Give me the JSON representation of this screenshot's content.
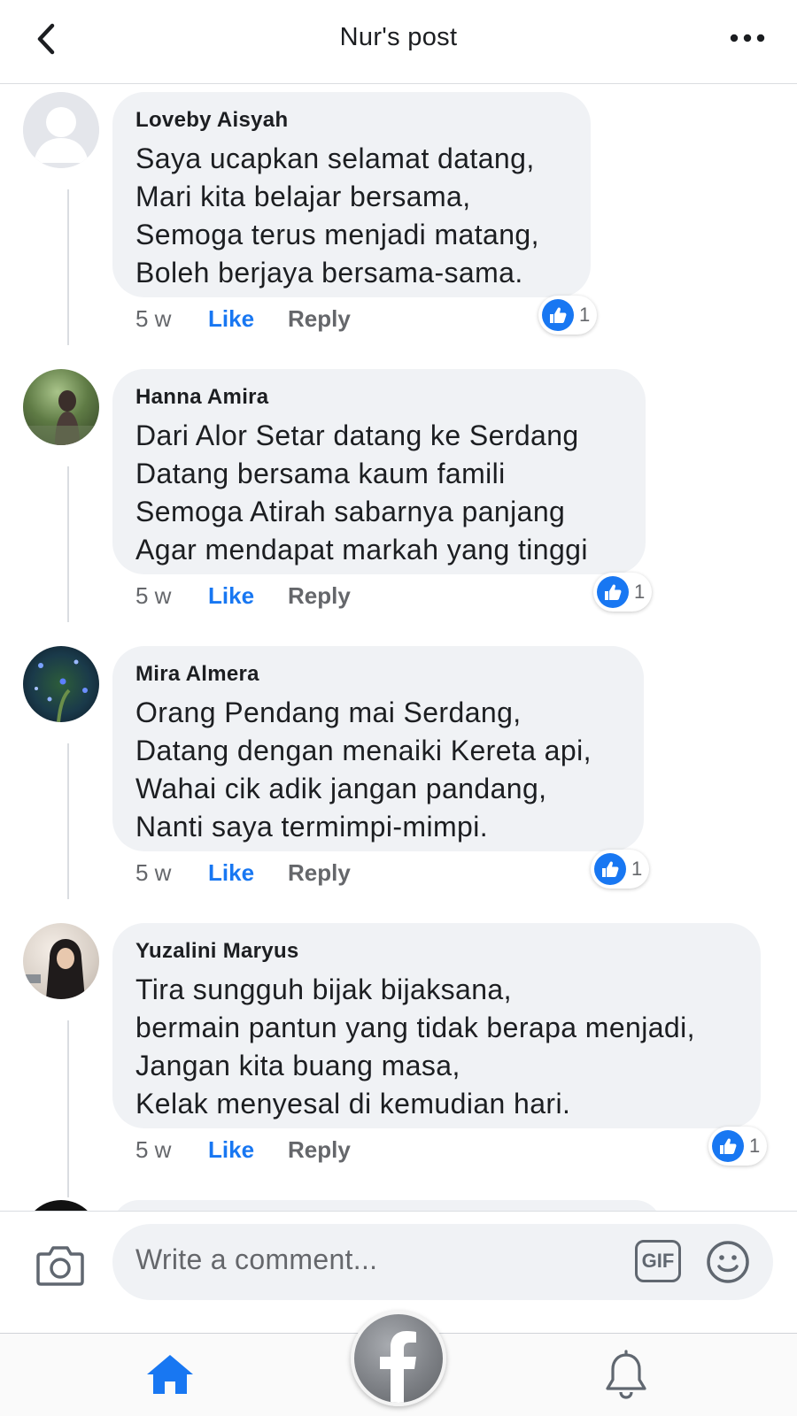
{
  "header": {
    "title": "Nur's post"
  },
  "comments": [
    {
      "author": "Loveby Aisyah",
      "lines": [
        "Saya ucapkan selamat datang,",
        "Mari kita belajar bersama,",
        "Semoga terus menjadi matang,",
        "Boleh berjaya bersama-sama."
      ],
      "time": "5 w",
      "like": "Like",
      "reply": "Reply",
      "reactions": "1"
    },
    {
      "author": "Hanna Amira",
      "lines": [
        "Dari Alor Setar datang ke Serdang",
        "Datang bersama kaum famili",
        "Semoga Atirah sabarnya panjang",
        "Agar mendapat markah yang tinggi"
      ],
      "time": "5 w",
      "like": "Like",
      "reply": "Reply",
      "reactions": "1"
    },
    {
      "author": "Mira Almera",
      "lines": [
        "Orang Pendang mai Serdang,",
        "Datang dengan menaiki Kereta api,",
        "Wahai cik adik jangan pandang,",
        "Nanti saya termimpi-mimpi."
      ],
      "time": "5 w",
      "like": "Like",
      "reply": "Reply",
      "reactions": "1"
    },
    {
      "author": "Yuzalini Maryus",
      "lines": [
        "Tira sungguh bijak bijaksana,",
        "bermain pantun yang tidak berapa menjadi,",
        "Jangan kita buang masa,",
        "Kelak menyesal di kemudian hari."
      ],
      "time": "5 w",
      "like": "Like",
      "reply": "Reply",
      "reactions": "1"
    }
  ],
  "composer": {
    "placeholder": "Write a comment...",
    "gif_label": "GIF"
  },
  "colors": {
    "accent": "#1877f2",
    "bubble": "#f0f2f5",
    "muted": "#65676b"
  },
  "icons": [
    "back-arrow-icon",
    "more-dots-icon",
    "thumbs-up-icon",
    "camera-icon",
    "gif-icon",
    "emoji-icon",
    "home-icon",
    "facebook-icon",
    "bell-icon"
  ]
}
